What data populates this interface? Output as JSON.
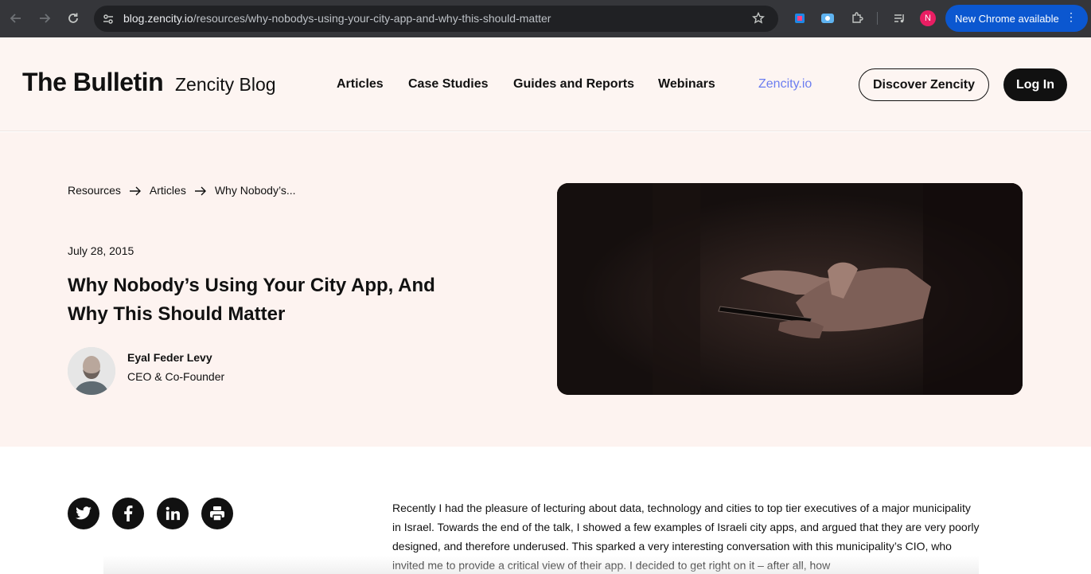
{
  "browser": {
    "url_host": "blog.zencity.io",
    "url_path": "/resources/why-nobodys-using-your-city-app-and-why-this-should-matter",
    "profile_initial": "N",
    "update_label": "New Chrome available",
    "icons": [
      "back-icon",
      "forward-icon",
      "reload-icon",
      "site-info-icon",
      "star-icon",
      "extension-icon",
      "media-icon"
    ]
  },
  "header": {
    "brand": "The Bulletin",
    "brand_sub": "Zencity Blog",
    "nav": {
      "articles": "Articles",
      "case_studies": "Case Studies",
      "guides": "Guides and Reports",
      "webinars": "Webinars",
      "zencity": "Zencity.io"
    },
    "discover_button": "Discover Zencity",
    "login_button": "Log In",
    "accent_color": "#6c7ef0"
  },
  "hero": {
    "breadcrumb": {
      "item1": "Resources",
      "item2": "Articles",
      "item3": "Why Nobody’s..."
    },
    "date": "July 28, 2015",
    "title": "Why Nobody’s Using Your City App, And Why This Should Matter",
    "author_name": "Eyal Feder Levy",
    "author_role": "CEO & Co-Founder"
  },
  "share": {
    "icons": [
      "twitter-icon",
      "facebook-icon",
      "linkedin-icon",
      "print-icon"
    ]
  },
  "article": {
    "body": "Recently I had the pleasure of lecturing about data, technology and cities to top tier executives of a major municipality in Israel. Towards the end of the talk, I showed a few examples of Israeli city apps, and argued that they are very poorly designed, and therefore underused. This sparked a very interesting conversation with this municipality’s CIO, who invited me to provide a critical view of their app. I decided to get right on it – after all, how"
  }
}
